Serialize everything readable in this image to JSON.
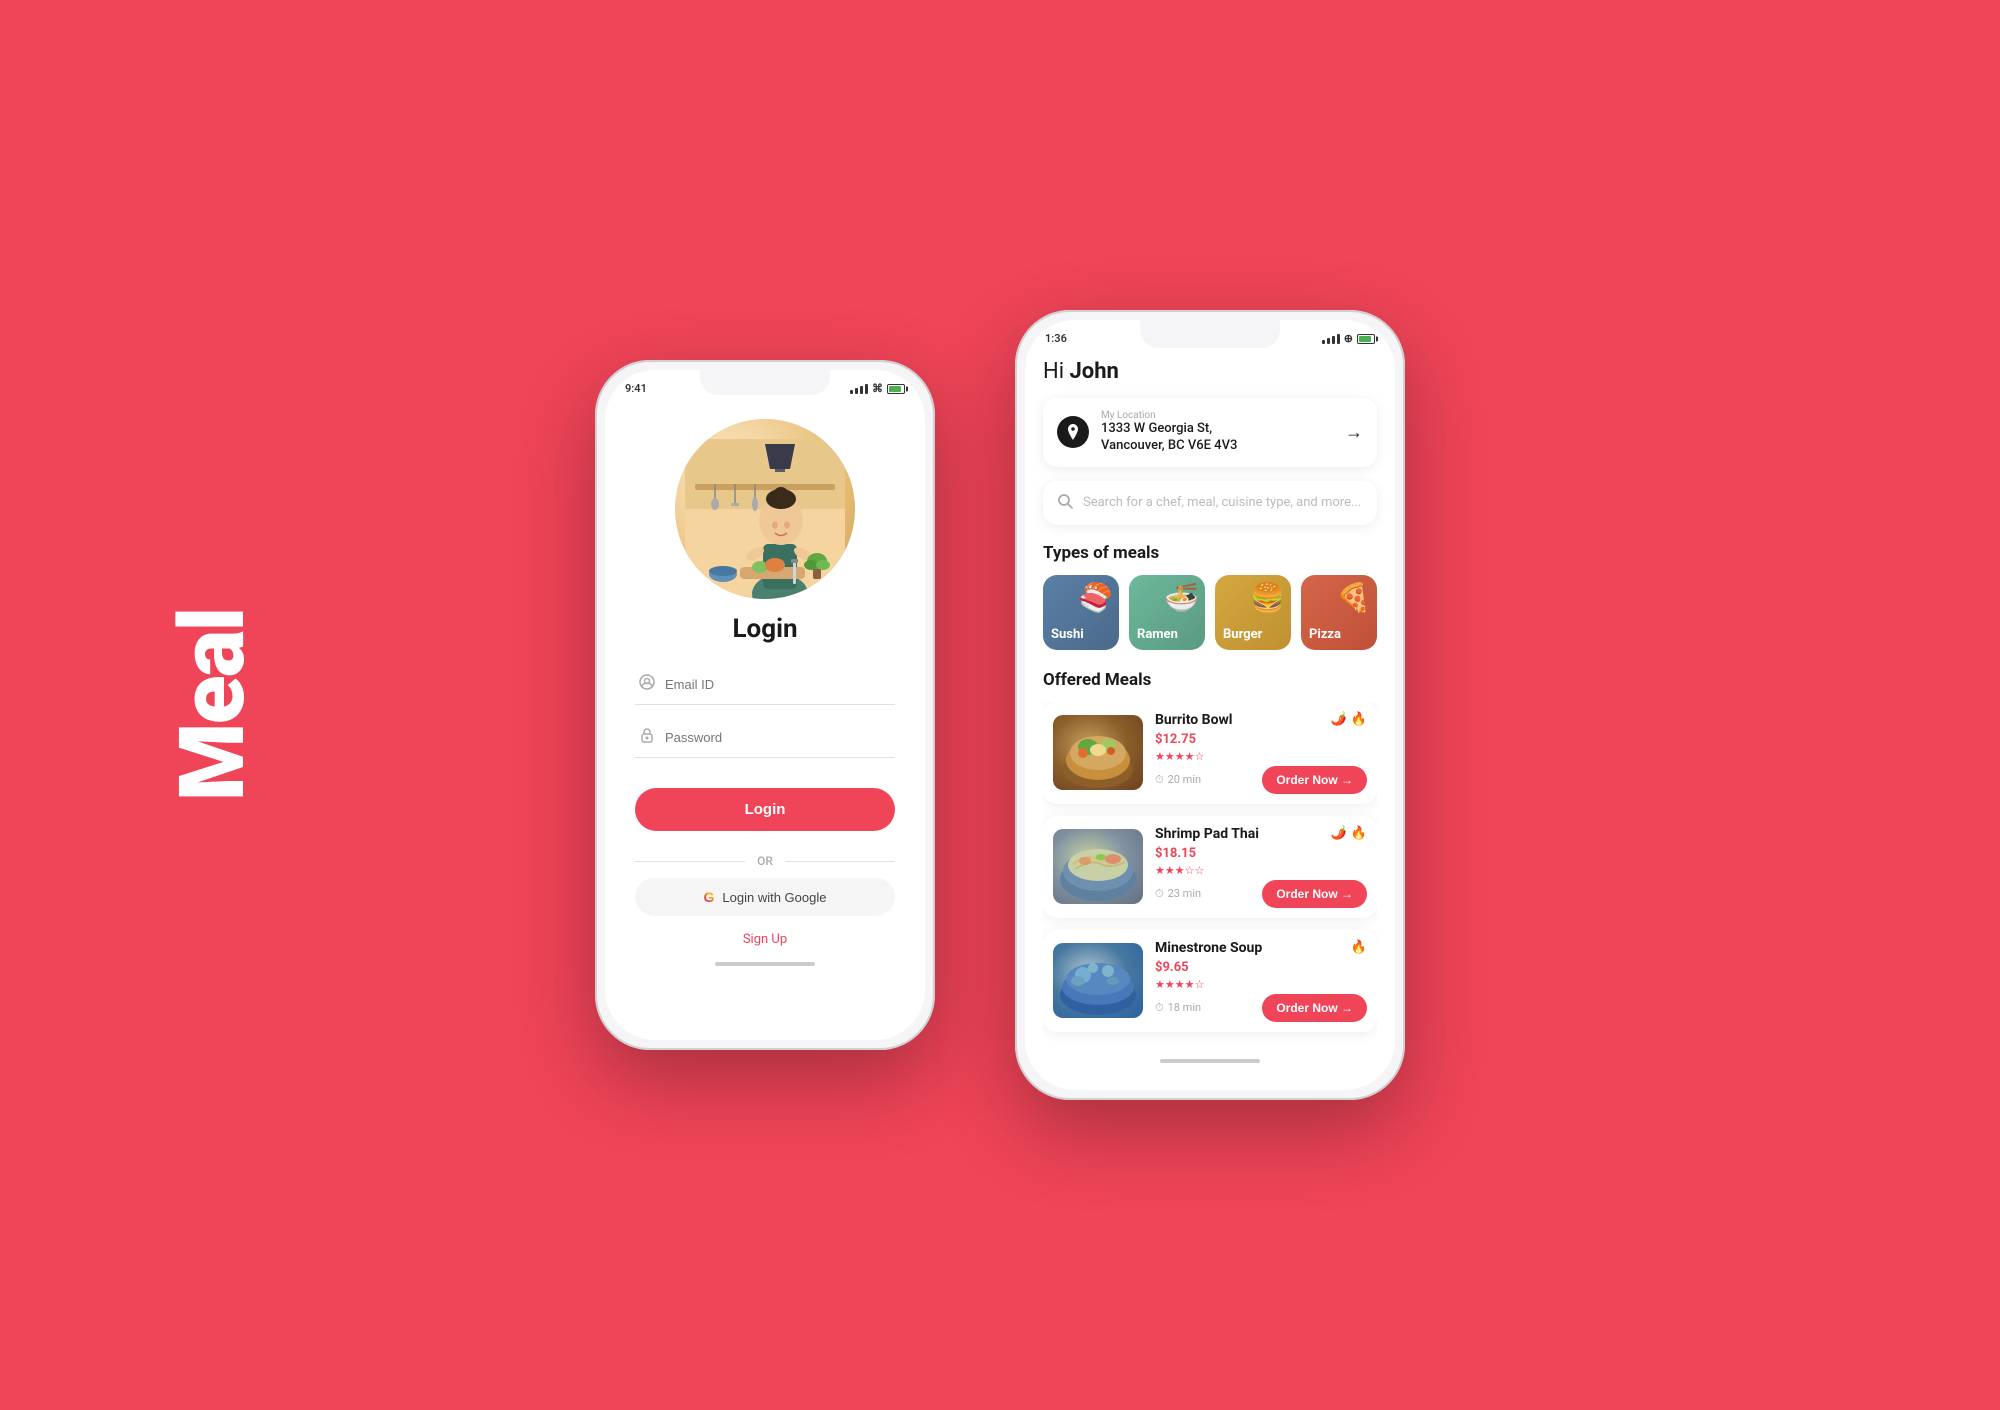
{
  "app": {
    "title": "Meal",
    "background_color": "#F04458"
  },
  "login_phone": {
    "status_bar": {
      "time": "9:41",
      "icons": [
        "signal",
        "wifi",
        "battery"
      ]
    },
    "title": "Login",
    "email_placeholder": "Email ID",
    "password_placeholder": "Password",
    "login_button": "Login",
    "or_text": "OR",
    "google_button": "Login with Google",
    "signup_text": "Sign Up"
  },
  "home_phone": {
    "status_bar": {
      "time": "1:36",
      "icons": [
        "signal",
        "wifi",
        "battery"
      ]
    },
    "greeting": "Hi ",
    "username": "John",
    "location": {
      "label": "My Location",
      "address_line1": "1333 W Georgia St,",
      "address_line2": "Vancouver, BC V6E 4V3"
    },
    "search_placeholder": "Search for a chef, meal, cuisine type, and more...",
    "meal_types_title": "Types of meals",
    "meal_types": [
      {
        "name": "Sushi",
        "emoji": "🍣",
        "color_class": "meal-type-sushi"
      },
      {
        "name": "Ramen",
        "emoji": "🍜",
        "color_class": "meal-type-ramen"
      },
      {
        "name": "Burger",
        "emoji": "🍔",
        "color_class": "meal-type-burger"
      },
      {
        "name": "Pizza",
        "emoji": "🍕",
        "color_class": "meal-type-pizza"
      }
    ],
    "offered_meals_title": "Offered Meals",
    "meals": [
      {
        "name": "Burrito Bowl",
        "price": "$12.75",
        "stars": 4,
        "time": "20 min",
        "image_class": "meal-image-burrito",
        "order_btn": "Order Now →",
        "tags": [
          "🌶️",
          "🔥"
        ]
      },
      {
        "name": "Shrimp Pad Thai",
        "price": "$18.15",
        "stars": 3,
        "time": "23 min",
        "image_class": "meal-image-padthai",
        "order_btn": "Order Now →",
        "tags": [
          "🌶️",
          "🔥"
        ]
      },
      {
        "name": "Minestrone Soup",
        "price": "$9.65",
        "stars": 4,
        "time": "18 min",
        "image_class": "meal-image-minestrone",
        "order_btn": "Order Now →",
        "tags": [
          "🔥"
        ]
      }
    ]
  }
}
